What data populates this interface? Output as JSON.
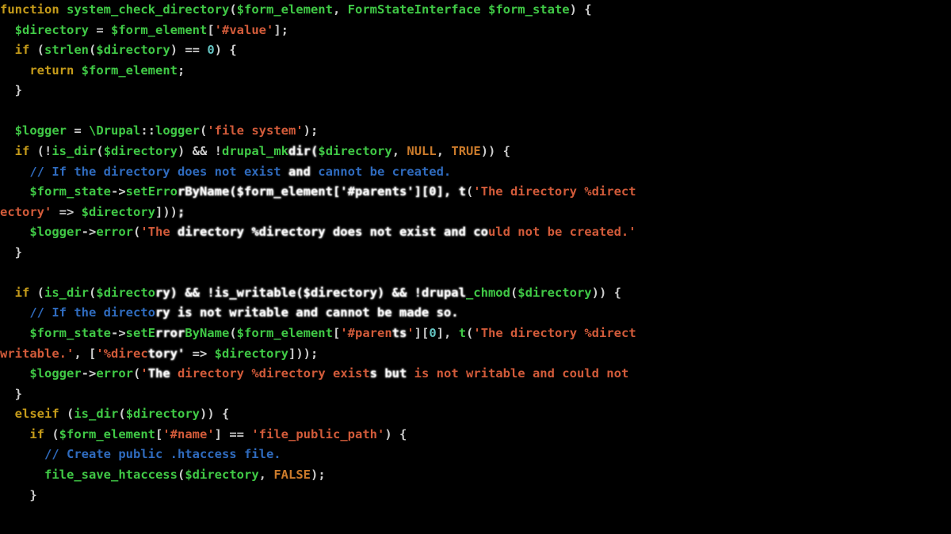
{
  "code": {
    "lines": [
      {
        "t": "function system_check_directory($form_element, FormStateInterface $form_state) {",
        "i": 0,
        "spans": [
          {
            "t": "function",
            "c": "kw"
          },
          {
            "t": " ",
            "c": "op"
          },
          {
            "t": "system_check_directory",
            "c": "fn"
          },
          {
            "t": "(",
            "c": "op"
          },
          {
            "t": "$form_element",
            "c": "var"
          },
          {
            "t": ", ",
            "c": "op"
          },
          {
            "t": "FormStateInterface",
            "c": "cls"
          },
          {
            "t": " ",
            "c": "op"
          },
          {
            "t": "$form_state",
            "c": "var"
          },
          {
            "t": ") {",
            "c": "op"
          }
        ]
      },
      {
        "t": "  $directory = $form_element['#value'];",
        "i": 1,
        "spans": [
          {
            "t": "  ",
            "c": "op"
          },
          {
            "t": "$directory",
            "c": "var"
          },
          {
            "t": " = ",
            "c": "op"
          },
          {
            "t": "$form_element",
            "c": "var"
          },
          {
            "t": "[",
            "c": "op"
          },
          {
            "t": "'#value'",
            "c": "str"
          },
          {
            "t": "];",
            "c": "op"
          }
        ]
      },
      {
        "t": "  if (strlen($directory) == 0) {",
        "i": 1,
        "spans": [
          {
            "t": "  ",
            "c": "op"
          },
          {
            "t": "if",
            "c": "kw"
          },
          {
            "t": " (",
            "c": "op"
          },
          {
            "t": "strlen",
            "c": "fn"
          },
          {
            "t": "(",
            "c": "op"
          },
          {
            "t": "$directory",
            "c": "var"
          },
          {
            "t": ") == ",
            "c": "op"
          },
          {
            "t": "0",
            "c": "num"
          },
          {
            "t": ") {",
            "c": "op"
          }
        ]
      },
      {
        "t": "    return $form_element;",
        "i": 2,
        "spans": [
          {
            "t": "    ",
            "c": "op"
          },
          {
            "t": "return",
            "c": "kw"
          },
          {
            "t": " ",
            "c": "op"
          },
          {
            "t": "$form_element",
            "c": "var"
          },
          {
            "t": ";",
            "c": "op"
          }
        ]
      },
      {
        "t": "  }",
        "i": 1,
        "spans": [
          {
            "t": "  }",
            "c": "op"
          }
        ]
      },
      {
        "t": "",
        "i": 0,
        "spans": [
          {
            "t": " ",
            "c": "op"
          }
        ]
      },
      {
        "t": "  $logger = \\Drupal::logger('file system');",
        "i": 1,
        "spans": [
          {
            "t": "  ",
            "c": "op"
          },
          {
            "t": "$logger",
            "c": "var"
          },
          {
            "t": " = ",
            "c": "op"
          },
          {
            "t": "\\Drupal",
            "c": "cls"
          },
          {
            "t": "::",
            "c": "op"
          },
          {
            "t": "logger",
            "c": "fn"
          },
          {
            "t": "(",
            "c": "op"
          },
          {
            "t": "'file system'",
            "c": "str"
          },
          {
            "t": ");",
            "c": "op"
          }
        ]
      },
      {
        "t": "  if (!is_dir($directory) && !drupal_mkdir($directory, NULL, TRUE)) {",
        "i": 1,
        "spans": [
          {
            "t": "  ",
            "c": "op"
          },
          {
            "t": "if",
            "c": "kw"
          },
          {
            "t": " (!",
            "c": "op"
          },
          {
            "t": "is_dir",
            "c": "fn"
          },
          {
            "t": "(",
            "c": "op"
          },
          {
            "t": "$directory",
            "c": "var"
          },
          {
            "t": ") && !",
            "c": "op"
          },
          {
            "t": "drupal_mk",
            "c": "fn"
          },
          {
            "t": "dir",
            "c": "wh"
          },
          {
            "t": "(",
            "c": "wh"
          },
          {
            "t": "$directory",
            "c": "var"
          },
          {
            "t": ", ",
            "c": "op"
          },
          {
            "t": "NULL",
            "c": "const"
          },
          {
            "t": ", ",
            "c": "op"
          },
          {
            "t": "TRUE",
            "c": "const"
          },
          {
            "t": ")) {",
            "c": "op"
          }
        ],
        "overlay": true
      },
      {
        "t": "    // If the directory does not exist and cannot be created.",
        "i": 2,
        "spans": [
          {
            "t": "    ",
            "c": "op"
          },
          {
            "t": "// If the directory does not exist ",
            "c": "cmt"
          },
          {
            "t": "and",
            "c": "wh"
          },
          {
            "t": " cannot be created.",
            "c": "cmt"
          }
        ],
        "overlay": true
      },
      {
        "t": "    $form_state->setErrorByName($form_element['#parents'][0], t('The directory %direct",
        "i": 2,
        "spans": [
          {
            "t": "    ",
            "c": "op"
          },
          {
            "t": "$form_state",
            "c": "var"
          },
          {
            "t": "->",
            "c": "op"
          },
          {
            "t": "setErro",
            "c": "fn"
          },
          {
            "t": "rByName($form_element['#parents'][0], t",
            "c": "wh"
          },
          {
            "t": "(",
            "c": "op"
          },
          {
            "t": "'The directory %direct",
            "c": "str"
          }
        ],
        "overlay": true
      },
      {
        "t": "ectory' => $directory]));",
        "i": 0,
        "spans": [
          {
            "t": "ectory'",
            "c": "str"
          },
          {
            "t": " => ",
            "c": "op"
          },
          {
            "t": "$directory",
            "c": "var"
          },
          {
            "t": "]))",
            "c": "op"
          },
          {
            "t": ";",
            "c": "wh"
          }
        ],
        "overlay": true
      },
      {
        "t": "    $logger->error('The directory %directory does not exist and could not be created.'",
        "i": 2,
        "spans": [
          {
            "t": "    ",
            "c": "op"
          },
          {
            "t": "$logger",
            "c": "var"
          },
          {
            "t": "->",
            "c": "op"
          },
          {
            "t": "error",
            "c": "fn"
          },
          {
            "t": "(",
            "c": "op"
          },
          {
            "t": "'The",
            "c": "str"
          },
          {
            "t": " directory %directory does not exist and co",
            "c": "wh"
          },
          {
            "t": "uld not be created.'",
            "c": "str"
          }
        ],
        "overlay": true
      },
      {
        "t": "  }",
        "i": 1,
        "spans": [
          {
            "t": "  }",
            "c": "op"
          }
        ]
      },
      {
        "t": "",
        "i": 0,
        "spans": [
          {
            "t": " ",
            "c": "op"
          }
        ]
      },
      {
        "t": "  if (is_dir($directory) && !is_writable($directory) && !drupal_chmod($directory)) {",
        "i": 1,
        "spans": [
          {
            "t": "  ",
            "c": "op"
          },
          {
            "t": "if",
            "c": "kw"
          },
          {
            "t": " (",
            "c": "op"
          },
          {
            "t": "is_dir",
            "c": "fn"
          },
          {
            "t": "(",
            "c": "op"
          },
          {
            "t": "$directo",
            "c": "var"
          },
          {
            "t": "ry) && !is_writable($directory) && !drupal",
            "c": "wh"
          },
          {
            "t": "_chmod",
            "c": "fn"
          },
          {
            "t": "(",
            "c": "op"
          },
          {
            "t": "$directory",
            "c": "var"
          },
          {
            "t": ")) {",
            "c": "op"
          }
        ],
        "overlay": true
      },
      {
        "t": "    // If the directory is not writable and cannot be made so.",
        "i": 2,
        "spans": [
          {
            "t": "    ",
            "c": "op"
          },
          {
            "t": "// If the directo",
            "c": "cmt"
          },
          {
            "t": "ry is not writable and cannot be made so.",
            "c": "wh"
          }
        ],
        "overlay": true
      },
      {
        "t": "    $form_state->setErrorByName($form_element['#parents'][0], t('The directory %direct",
        "i": 2,
        "spans": [
          {
            "t": "    ",
            "c": "op"
          },
          {
            "t": "$form_state",
            "c": "var"
          },
          {
            "t": "->",
            "c": "op"
          },
          {
            "t": "setE",
            "c": "fn"
          },
          {
            "t": "rror",
            "c": "wh"
          },
          {
            "t": "ByName",
            "c": "fn"
          },
          {
            "t": "(",
            "c": "op"
          },
          {
            "t": "$form_element",
            "c": "var"
          },
          {
            "t": "[",
            "c": "op"
          },
          {
            "t": "'#paren",
            "c": "str"
          },
          {
            "t": "ts",
            "c": "wh"
          },
          {
            "t": "'",
            "c": "str"
          },
          {
            "t": "][",
            "c": "op"
          },
          {
            "t": "0",
            "c": "num"
          },
          {
            "t": "], ",
            "c": "op"
          },
          {
            "t": "t",
            "c": "fn"
          },
          {
            "t": "(",
            "c": "op"
          },
          {
            "t": "'The directory %direct",
            "c": "str"
          }
        ],
        "overlay": true
      },
      {
        "t": "writable.', ['%directory' => $directory]));",
        "i": 0,
        "spans": [
          {
            "t": "writable.'",
            "c": "str"
          },
          {
            "t": ", [",
            "c": "op"
          },
          {
            "t": "'%direc",
            "c": "str"
          },
          {
            "t": "tory'",
            "c": "wh"
          },
          {
            "t": " => ",
            "c": "op"
          },
          {
            "t": "$directory",
            "c": "var"
          },
          {
            "t": "]));",
            "c": "op"
          }
        ],
        "overlay": true
      },
      {
        "t": "    $logger->error('The directory %directory exists but is not writable and could not ",
        "i": 2,
        "spans": [
          {
            "t": "    ",
            "c": "op"
          },
          {
            "t": "$logger",
            "c": "var"
          },
          {
            "t": "->",
            "c": "op"
          },
          {
            "t": "error",
            "c": "fn"
          },
          {
            "t": "(",
            "c": "op"
          },
          {
            "t": "'",
            "c": "str"
          },
          {
            "t": "The",
            "c": "wh"
          },
          {
            "t": " directory %directory exist",
            "c": "str"
          },
          {
            "t": "s but",
            "c": "wh"
          },
          {
            "t": " is not writable and could not ",
            "c": "str"
          }
        ],
        "overlay": true
      },
      {
        "t": "  }",
        "i": 1,
        "spans": [
          {
            "t": "  }",
            "c": "op"
          }
        ]
      },
      {
        "t": "  elseif (is_dir($directory)) {",
        "i": 1,
        "spans": [
          {
            "t": "  ",
            "c": "op"
          },
          {
            "t": "elseif",
            "c": "kw"
          },
          {
            "t": " (",
            "c": "op"
          },
          {
            "t": "is_dir",
            "c": "fn"
          },
          {
            "t": "(",
            "c": "op"
          },
          {
            "t": "$directory",
            "c": "var"
          },
          {
            "t": ")) {",
            "c": "op"
          }
        ]
      },
      {
        "t": "    if ($form_element['#name'] == 'file_public_path') {",
        "i": 2,
        "spans": [
          {
            "t": "    ",
            "c": "op"
          },
          {
            "t": "if",
            "c": "kw"
          },
          {
            "t": " (",
            "c": "op"
          },
          {
            "t": "$form_element",
            "c": "var"
          },
          {
            "t": "[",
            "c": "op"
          },
          {
            "t": "'#name'",
            "c": "str"
          },
          {
            "t": "] == ",
            "c": "op"
          },
          {
            "t": "'file_public_path'",
            "c": "str"
          },
          {
            "t": ") {",
            "c": "op"
          }
        ]
      },
      {
        "t": "      // Create public .htaccess file.",
        "i": 3,
        "spans": [
          {
            "t": "      ",
            "c": "op"
          },
          {
            "t": "// Create public .htaccess file.",
            "c": "cmt"
          }
        ]
      },
      {
        "t": "      file_save_htaccess($directory, FALSE);",
        "i": 3,
        "spans": [
          {
            "t": "      ",
            "c": "op"
          },
          {
            "t": "file_save_htaccess",
            "c": "fn"
          },
          {
            "t": "(",
            "c": "op"
          },
          {
            "t": "$directory",
            "c": "var"
          },
          {
            "t": ", ",
            "c": "op"
          },
          {
            "t": "FALSE",
            "c": "const"
          },
          {
            "t": ");",
            "c": "op"
          }
        ]
      },
      {
        "t": "    }",
        "i": 2,
        "spans": [
          {
            "t": "    }",
            "c": "op"
          }
        ]
      }
    ]
  }
}
